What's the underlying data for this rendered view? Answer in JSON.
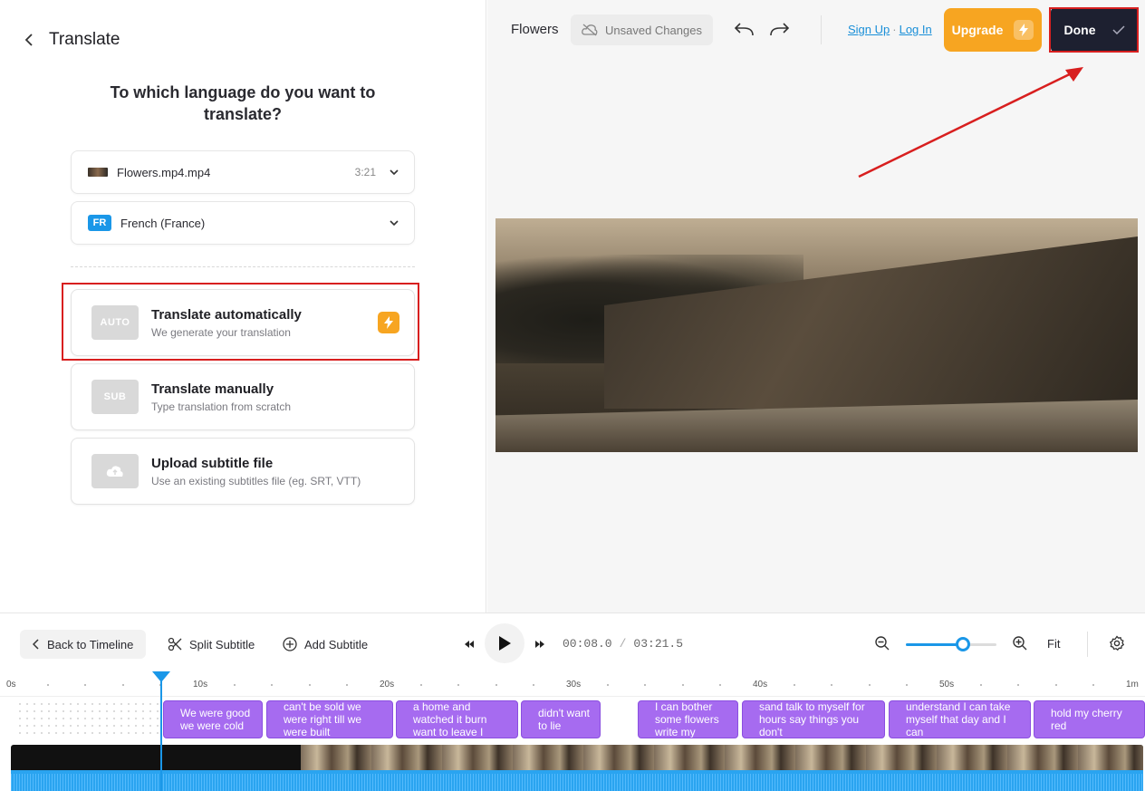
{
  "panel": {
    "title": "Translate",
    "question": "To which language do you want to translate?",
    "file": {
      "name": "Flowers.mp4.mp4",
      "duration": "3:21"
    },
    "language": {
      "code": "FR",
      "name": "French (France)"
    },
    "options": [
      {
        "icon_label": "AUTO",
        "title": "Translate automatically",
        "subtitle": "We generate your translation",
        "premium": true
      },
      {
        "icon_label": "SUB",
        "title": "Translate manually",
        "subtitle": "Type translation from scratch",
        "premium": false
      },
      {
        "icon_label": "",
        "title": "Upload subtitle file",
        "subtitle": "Use an existing subtitles file (eg. SRT, VTT)",
        "premium": false
      }
    ]
  },
  "topbar": {
    "project_name": "Flowers",
    "save_status": "Unsaved Changes",
    "sign_up": "Sign Up",
    "separator": "·",
    "log_in": "Log In",
    "upgrade": "Upgrade",
    "done": "Done"
  },
  "timeline": {
    "back_label": "Back to Timeline",
    "split_label": "Split Subtitle",
    "add_label": "Add Subtitle",
    "current_time": "00:08.0",
    "time_separator": "/",
    "total_time": "03:21.5",
    "zoom_level": 0.63,
    "fit_label": "Fit",
    "ruler_labels": [
      "0s",
      "10s",
      "20s",
      "30s",
      "40s",
      "50s",
      "1m"
    ],
    "subtitles": [
      "We were good we were cold",
      "can't be sold we were right till we were built",
      "a home and watched it burn want to leave I",
      "didn't want to lie",
      "I can bother some flowers write my",
      "sand talk to myself for hours say things you don't",
      "understand I can take myself that day and I can",
      "hold my cherry red"
    ]
  },
  "colors": {
    "accent": "#1a97e8",
    "upgrade": "#f7a521",
    "done_bg": "#1d2030",
    "subtitle_block": "#a66bf0",
    "highlight": "#d81f1f"
  }
}
